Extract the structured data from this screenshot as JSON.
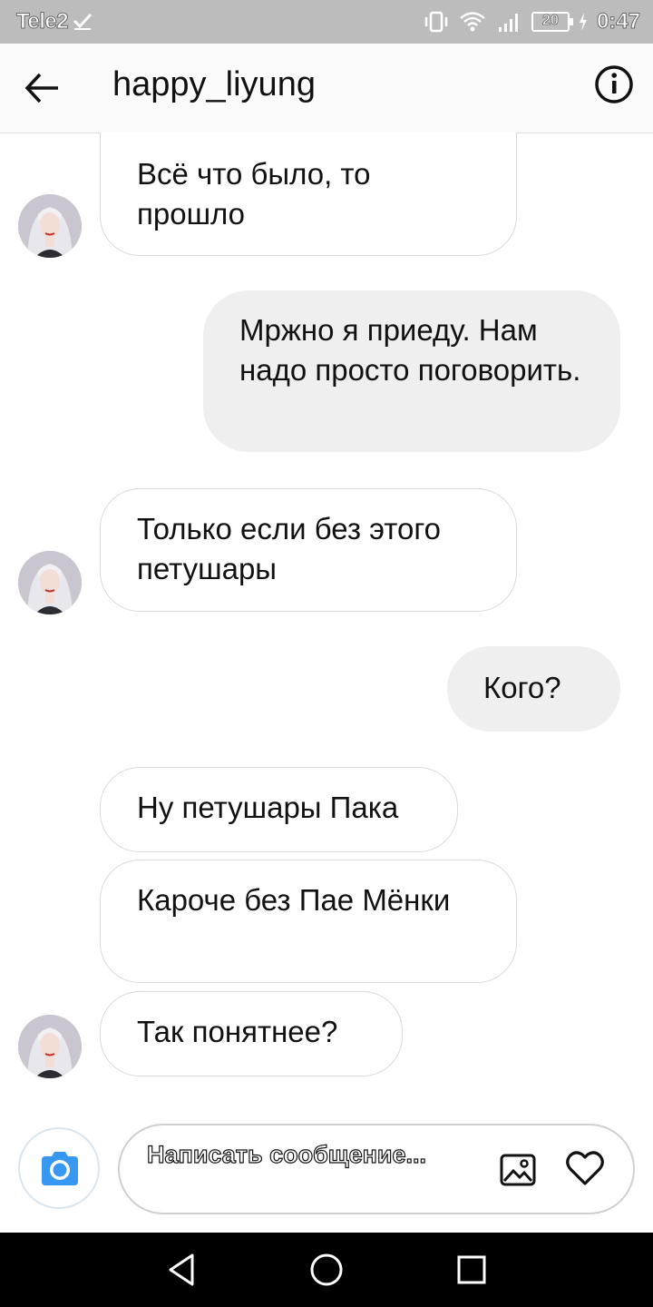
{
  "status_bar": {
    "carrier": "Tele2",
    "battery": "20",
    "time": "0:47"
  },
  "header": {
    "title": "happy_liyung"
  },
  "messages": [
    {
      "side": "incoming",
      "text": "Всё что было, то прошло"
    },
    {
      "side": "outgoing",
      "text": "Мржно я приеду. Нам надо просто поговорить."
    },
    {
      "side": "incoming",
      "text": "Только если без этого петушары"
    },
    {
      "side": "outgoing",
      "text": "Кого?"
    },
    {
      "side": "incoming",
      "text": "Ну петушары Пака"
    },
    {
      "side": "incoming",
      "text": "Кароче без Пае Мёнки"
    },
    {
      "side": "incoming",
      "text": "Так понятнее?"
    }
  ],
  "composer": {
    "placeholder": "Написать сообщение..."
  },
  "colors": {
    "status_bar": "#bcbcbc",
    "outgoing_bubble": "#efefef",
    "incoming_border": "#dbdbdb",
    "camera_blue": "#3897f0",
    "navbar": "#000000"
  }
}
